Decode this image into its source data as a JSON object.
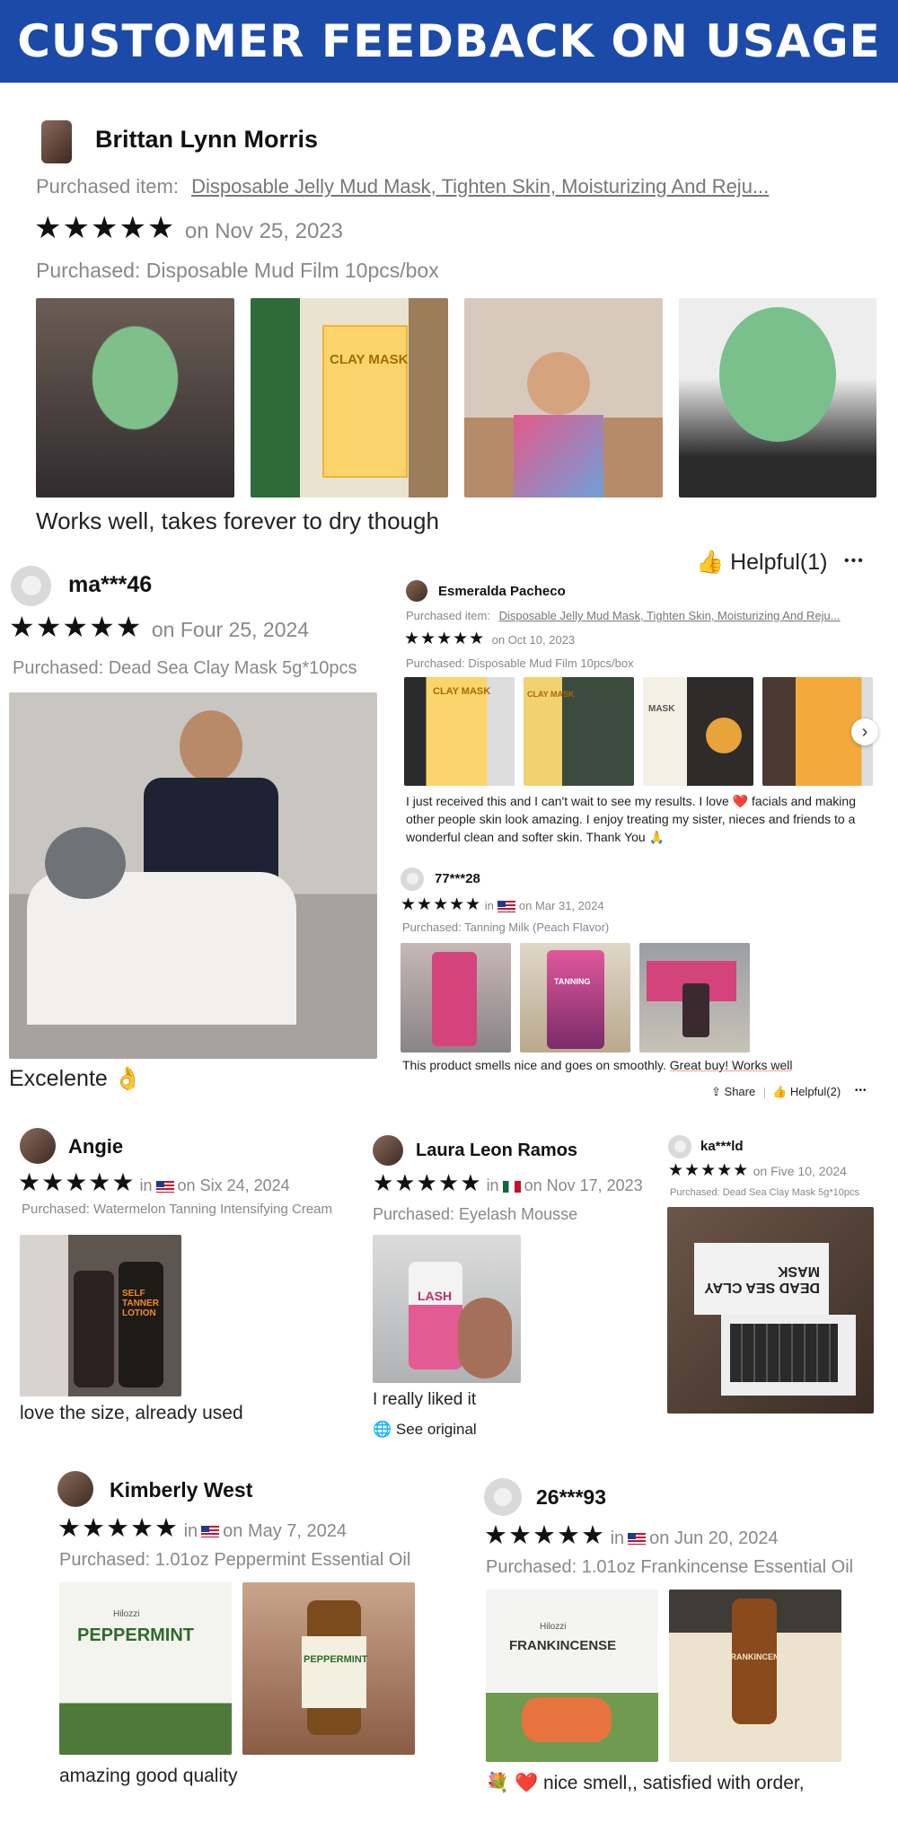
{
  "banner": {
    "title": "CUSTOMER FEEDBACK ON USAGE"
  },
  "review1": {
    "name": "Brittan Lynn Morris",
    "item_label": "Purchased item:",
    "item_link": "Disposable Jelly Mud Mask, Tighten Skin, Moisturizing And Reju...",
    "stars": "★★★★★",
    "date": "on Nov 25, 2023",
    "purchased": "Purchased: Disposable Mud Film 10pcs/box",
    "comment": "Works well, takes forever to dry though",
    "helpful": "Helpful(1)",
    "more": "•••",
    "photo_text": "CLAY MASK"
  },
  "review2": {
    "name": "ma***46",
    "stars": "★★★★★",
    "date": "on Four  25, 2024",
    "purchased": "Purchased: Dead Sea Clay Mask 5g*10pcs",
    "comment": "Excelente 👌"
  },
  "review3": {
    "name": "Esmeralda Pacheco",
    "item_label": "Purchased item:",
    "item_link": "Disposable Jelly Mud Mask, Tighten Skin, Moisturizing And Reju...",
    "stars": "★★★★★",
    "date": "on Oct 10, 2023",
    "purchased": "Purchased: Disposable Mud Film 10pcs/box",
    "comment": "I just received this and I can't wait to see my results. I love ❤️ facials and making other people skin look amazing. I enjoy treating my sister, nieces and friends to a wonderful clean and softer skin. Thank You 🙏",
    "next": "›",
    "photo_texts": [
      "CLAY MASK",
      "CLAY MASK",
      "MASK"
    ]
  },
  "review4": {
    "name": "77***28",
    "stars": "★★★★★",
    "in": "in",
    "date": "on Mar 31, 2024",
    "purchased": "Purchased: Tanning Milk (Peach Flavor)",
    "comment_plain": "This product smells nice and goes on smoothly.",
    "comment_underlined": "Great buy! Works well",
    "share": "Share",
    "helpful": "Helpful(2)",
    "more": "•••",
    "photo_text": "TANNING"
  },
  "review5": {
    "name": "Angie",
    "stars": "★★★★★",
    "in": "in",
    "date": "on Six  24, 2024",
    "purchased": "Purchased: Watermelon Tanning Intensifying Cream",
    "comment": "love the size, already used",
    "photo_text": "SELF TANNER LOTION"
  },
  "review6": {
    "name": "Laura Leon Ramos",
    "stars": "★★★★★",
    "in": "in",
    "date": "on Nov 17, 2023",
    "purchased": "Purchased: Eyelash Mousse",
    "comment": "I really liked it",
    "see_original": "See original",
    "photo_text": "LASH"
  },
  "review7": {
    "name": "ka***ld",
    "stars": "★★★★★",
    "date": "on Five  10, 2024",
    "purchased": "Purchased: Dead Sea Clay Mask 5g*10pcs",
    "photo_text": "DEAD SEA CLAY MASK"
  },
  "review8": {
    "name": "Kimberly West",
    "stars": "★★★★★",
    "in": "in",
    "date": "on May 7, 2024",
    "purchased": "Purchased: 1.01oz Peppermint Essential Oil",
    "comment": "amazing good quality",
    "photo_text": "PEPPERMINT",
    "brand": "Hilozzi"
  },
  "review9": {
    "name": "26***93",
    "stars": "★★★★★",
    "in": "in",
    "date": "on Jun 20, 2024",
    "purchased": "Purchased: 1.01oz Frankincense Essential Oil",
    "comment": "💐 ❤️ nice smell,, satisfied with order,",
    "photo_text": "FRANKINCENSE",
    "brand": "Hilozzi"
  },
  "colors": {
    "banner": "#1c4aa8",
    "text": "#222222",
    "meta": "#888888"
  }
}
